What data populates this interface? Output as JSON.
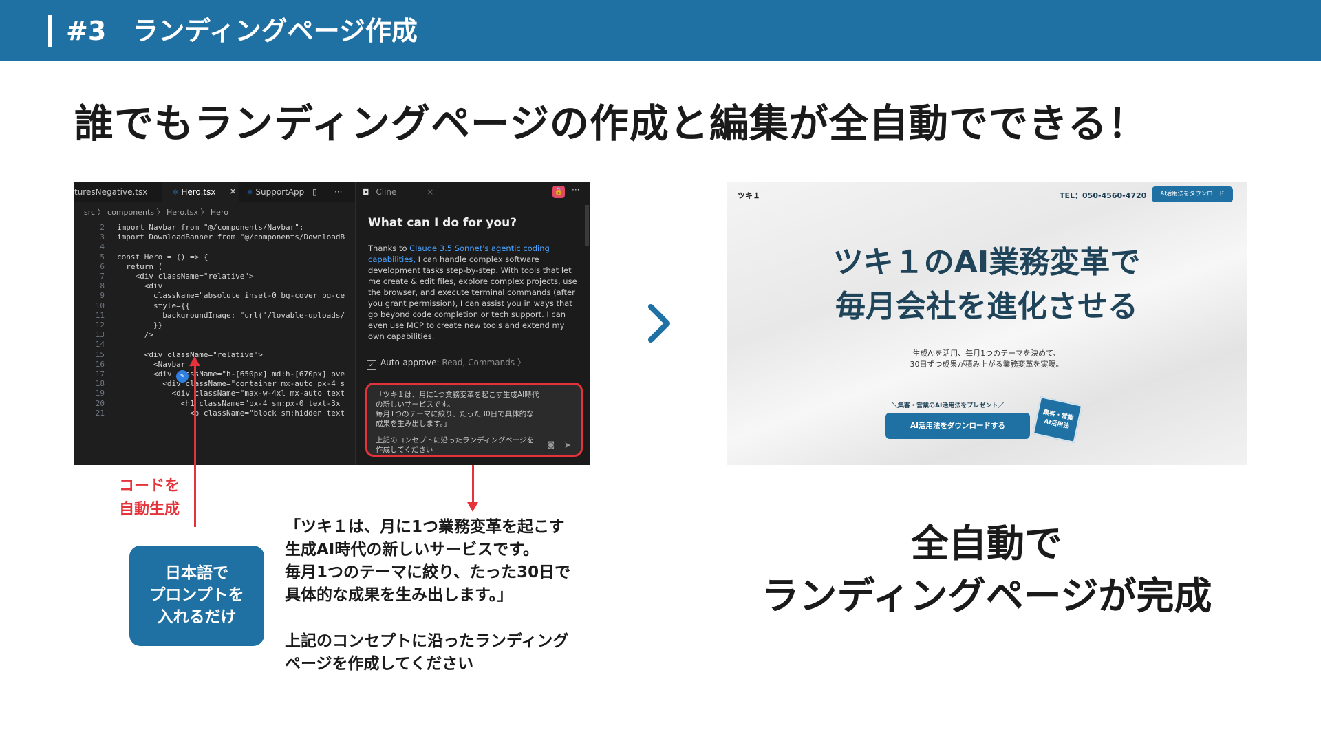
{
  "header": {
    "title": "#3　ランディングページ作成"
  },
  "headline": "誰でもランディングページの作成と編集が全自動でできる！",
  "editor": {
    "tabs": [
      {
        "label": "turesNegative.tsx"
      },
      {
        "label": "Hero.tsx",
        "close": "×"
      },
      {
        "label": "SupportApp"
      }
    ],
    "tab_more": "···",
    "breadcrumb": "src 〉 components 〉 Hero.tsx 〉 Hero",
    "code_lines": [
      {
        "n": "2",
        "t": "import Navbar from \"@/components/Navbar\";"
      },
      {
        "n": "3",
        "t": "import DownloadBanner from \"@/components/DownloadB"
      },
      {
        "n": "4",
        "t": ""
      },
      {
        "n": "5",
        "t": "const Hero = () => {"
      },
      {
        "n": "6",
        "t": "  return ("
      },
      {
        "n": "7",
        "t": "    <div className=\"relative\">"
      },
      {
        "n": "8",
        "t": "      <div"
      },
      {
        "n": "9",
        "t": "        className=\"absolute inset-0 bg-cover bg-ce"
      },
      {
        "n": "10",
        "t": "        style={{"
      },
      {
        "n": "11",
        "t": "          backgroundImage: \"url('/lovable-uploads/"
      },
      {
        "n": "12",
        "t": "        }}"
      },
      {
        "n": "13",
        "t": "      />"
      },
      {
        "n": "14",
        "t": ""
      },
      {
        "n": "15",
        "t": "      <div className=\"relative\">"
      },
      {
        "n": "16",
        "t": "        <Navbar />"
      },
      {
        "n": "17",
        "t": "        <div className=\"h-[650px] md:h-[670px] ove"
      },
      {
        "n": "18",
        "t": "          <div className=\"container mx-auto px-4 s"
      },
      {
        "n": "19",
        "t": "            <div className=\"max-w-4xl mx-auto text"
      },
      {
        "n": "20",
        "t": "              <h1 className=\"px-4 sm:px-0 text-3x"
      },
      {
        "n": "21",
        "t": "                <p className=\"block sm:hidden text"
      }
    ]
  },
  "cline": {
    "tab_label": "Cline",
    "heading": "What can I do for you?",
    "desc_pre": "Thanks to ",
    "desc_link": "Claude 3.5 Sonnet's agentic coding capabilities,",
    "desc_post": " I can handle complex software development tasks step-by-step. With tools that let me create & edit files, explore complex projects, use the browser, and execute terminal commands (after you grant permission), I can assist you in ways that go beyond code completion or tech support. I can even use MCP to create new tools and extend my own capabilities.",
    "auto_approve_label": "Auto-approve:",
    "auto_approve_value": "Read, Commands 〉",
    "prompt_line1": "「ツキ１は、月に1つ業務変革を起こす生成AI時代\nの新しいサービスです。\n毎月1つのテーマに絞り、たった30日で具体的な\n成果を生み出します。」",
    "prompt_line2": "上記のコンセプトに沿ったランディングページを\n作成してください"
  },
  "annotations": {
    "code_note": "コードを\n自動生成",
    "jp_box": "日本語で\nプロンプトを\n入れるだけ",
    "quote_main": "「ツキ１は、月に1つ業務変革を起こす\n生成AI時代の新しいサービスです。\n毎月1つのテーマに絞り、たった30日で\n具体的な成果を生み出します。」",
    "quote_instruction": "上記のコンセプトに沿ったランディング\nページを作成してください"
  },
  "landing": {
    "brand": "ツキ１",
    "tel": "TEL：050-4560-4720",
    "download_button": "AI活用法をダウンロード",
    "headline": "ツキ１のAI業務変革で\n毎月会社を進化させる",
    "sub": "生成AIを活用、毎月1つのテーマを決めて、\n30日ずつ成果が積み上がる業務変革を実現。",
    "banner": "＼集客・営業のAI活用法をプレゼント／",
    "cta": "AI活用法をダウンロードする",
    "card": "集客・営業\nAI活用法"
  },
  "result": "全自動で\nランディングページが完成",
  "colors": {
    "brand_blue": "#1f70a3",
    "accent_red": "#e5323b"
  }
}
